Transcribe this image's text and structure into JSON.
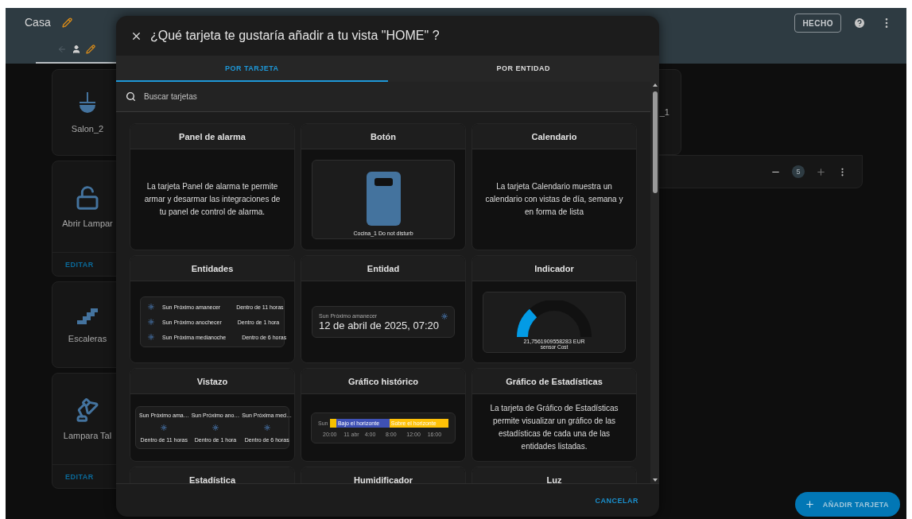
{
  "header": {
    "title": "Casa",
    "done_button": "HECHO"
  },
  "background_cards": [
    {
      "name": "Salon_2",
      "kind": "ceiling-lamp"
    },
    {
      "name": "Abrir Lampar",
      "kind": "lock",
      "action": "EDITAR"
    },
    {
      "name": "Escaleras",
      "kind": "stairs"
    },
    {
      "name": "Lampara Tal",
      "kind": "desk-lamp",
      "action": "EDITAR"
    }
  ],
  "right_card": {
    "name": "_1"
  },
  "stepper": {
    "value": "5"
  },
  "fab": {
    "label": "AÑADIR TARJETA"
  },
  "dialog": {
    "title": "¿Qué tarjeta te gustaría añadir a tu vista \"HOME\" ?",
    "tabs": [
      {
        "label": "POR TARJETA",
        "selected": true
      },
      {
        "label": "POR ENTIDAD",
        "selected": false
      }
    ],
    "search": {
      "placeholder": "Buscar tarjetas"
    },
    "cards": [
      {
        "title": "Panel de alarma",
        "kind": "description",
        "text": "La tarjeta Panel de alarma te permite armar y desarmar las integraciones de tu panel de control de alarma."
      },
      {
        "title": "Botón",
        "kind": "button",
        "label": "Cocina_1 Do not disturb"
      },
      {
        "title": "Calendario",
        "kind": "description",
        "text": "La tarjeta Calendario muestra un calendario con vistas de día, semana y en forma de lista"
      },
      {
        "title": "Entidades",
        "kind": "entities",
        "rows": [
          {
            "name": "Sun Próximo amanecer",
            "value": "Dentro de 11 horas"
          },
          {
            "name": "Sun Próximo anochecer",
            "value": "Dentro de 1 hora"
          },
          {
            "name": "Sun Próxima medianoche",
            "value": "Dentro de 6 horas"
          }
        ]
      },
      {
        "title": "Entidad",
        "kind": "entity",
        "name": "Sun Próximo amanecer",
        "value": "12 de abril de 2025, 07:20"
      },
      {
        "title": "Indicador",
        "kind": "gauge",
        "value": "21,7561909558283 EUR",
        "name": "sensor Cost"
      },
      {
        "title": "Vistazo",
        "kind": "glance",
        "items": [
          {
            "name": "Sun Próximo ama…",
            "value": "Dentro de 11 horas"
          },
          {
            "name": "Sun Próximo ano…",
            "value": "Dentro de 1 hora"
          },
          {
            "name": "Sun Próxima med…",
            "value": "Dentro de 6 horas"
          }
        ]
      },
      {
        "title": "Gráfico histórico",
        "kind": "history",
        "entity": "Sun",
        "segments": [
          {
            "color": "#f6c000"
          },
          {
            "label": "Bajo el horizonte",
            "color": "#3f51b5"
          },
          {
            "label": "Sobre el horizonte",
            "color": "#ffc107"
          }
        ],
        "ticks": [
          "20:00",
          "11 abr",
          "4:00",
          "8:00",
          "12:00",
          "16:00"
        ]
      },
      {
        "title": "Gráfico de Estadísticas",
        "kind": "description",
        "text": "La tarjeta de Gráfico de Estadísticas permite visualizar un gráfico de las estadísticas de cada una de las entidades listadas."
      },
      {
        "title": "Estadística",
        "kind": "partial"
      },
      {
        "title": "Humidificador",
        "kind": "partial"
      },
      {
        "title": "Luz",
        "kind": "partial"
      }
    ],
    "cancel_button": "CANCELAR"
  }
}
